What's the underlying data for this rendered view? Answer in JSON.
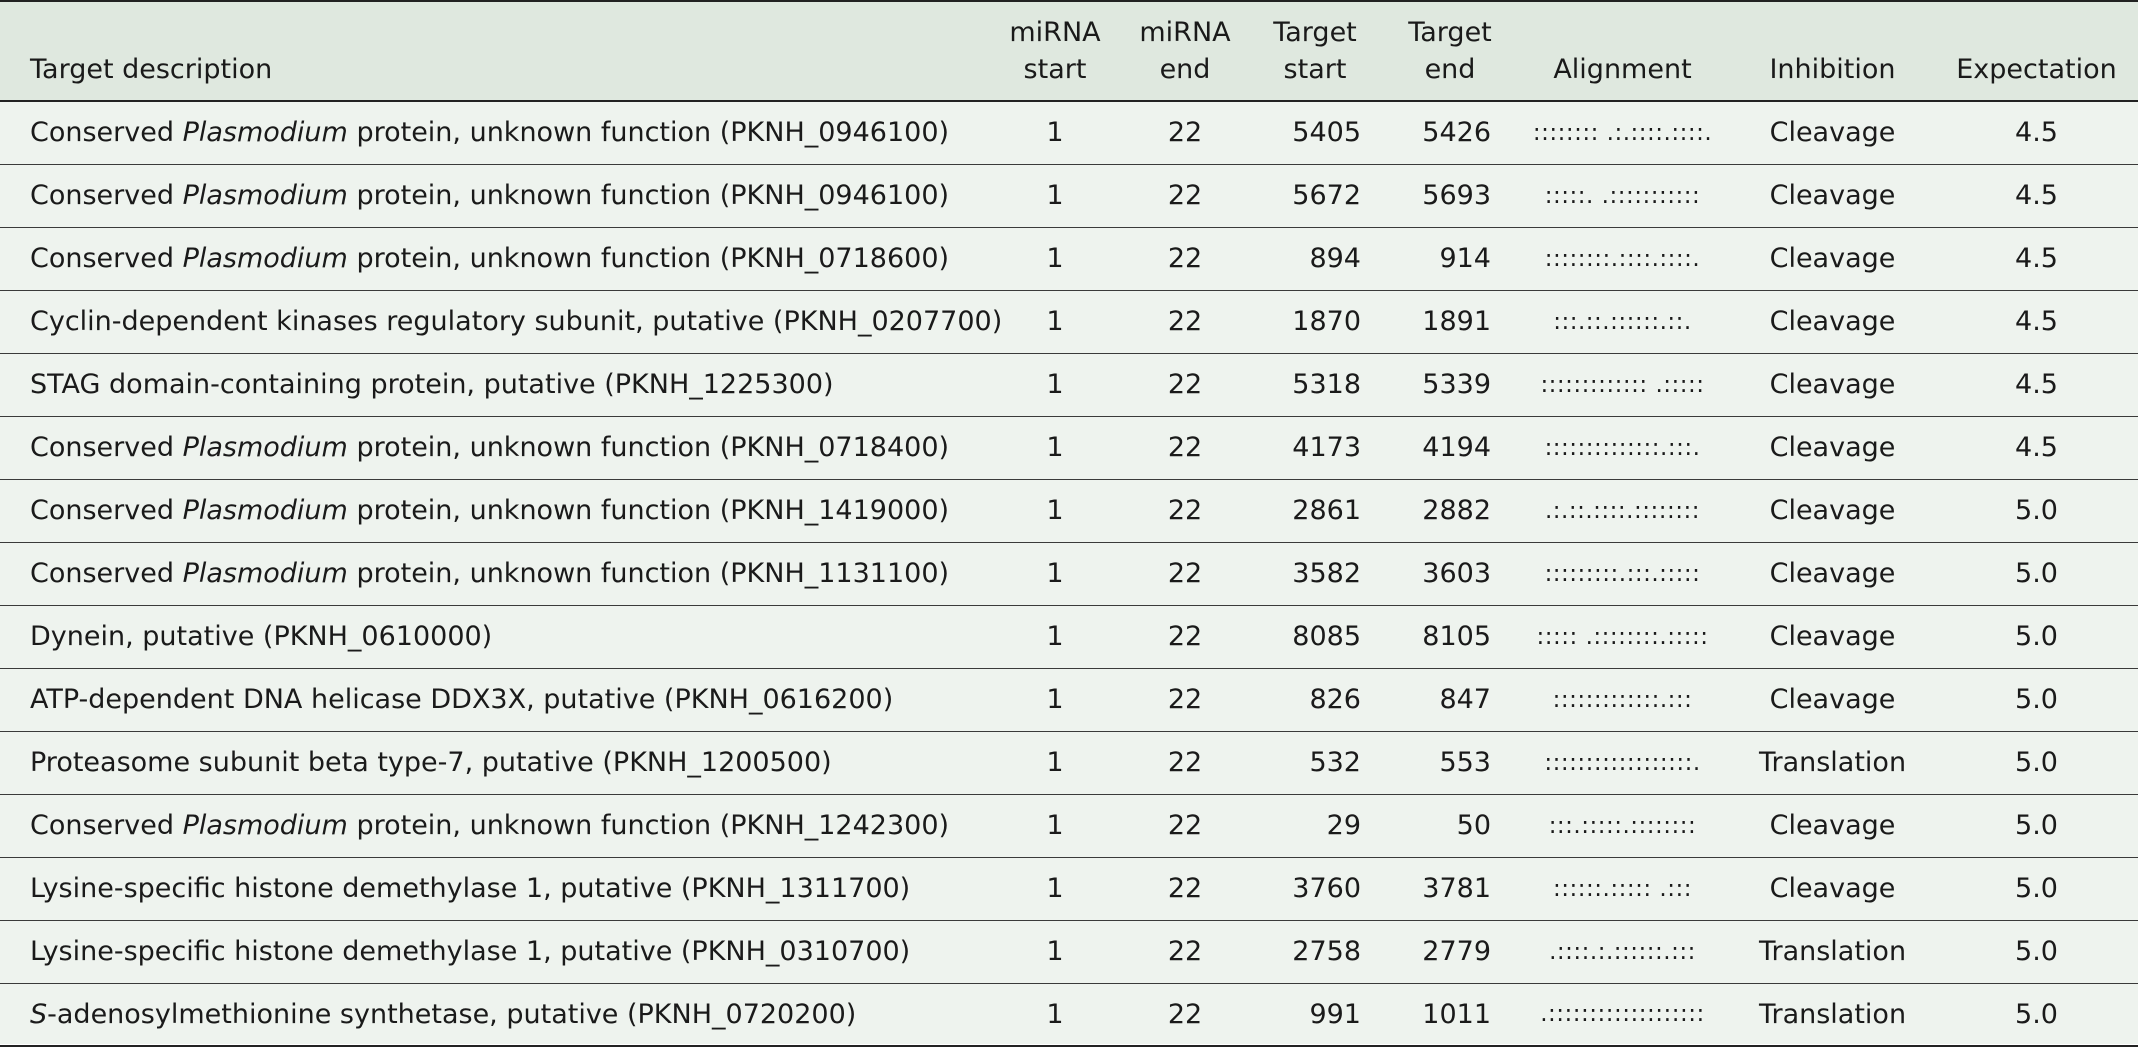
{
  "table": {
    "headers": {
      "desc": "Target description",
      "mirna_start": [
        "miRNA",
        "start"
      ],
      "mirna_end": [
        "miRNA",
        "end"
      ],
      "target_start": [
        "Target",
        "start"
      ],
      "target_end": [
        "Target",
        "end"
      ],
      "alignment": "Alignment",
      "inhibition": "Inhibition",
      "expectation": "Expectation"
    },
    "rows": [
      {
        "desc_pre": "Conserved ",
        "desc_ital": "Plasmodium",
        "desc_post": " protein, unknown function (PKNH_0946100)",
        "mirna_start": "1",
        "mirna_end": "22",
        "target_start": "5405",
        "target_end": "5426",
        "alignment": ":::::::: .:.::::.::::.",
        "inhibition": "Cleavage",
        "expectation": "4.5"
      },
      {
        "desc_pre": "Conserved ",
        "desc_ital": "Plasmodium",
        "desc_post": " protein, unknown function (PKNH_0946100)",
        "mirna_start": "1",
        "mirna_end": "22",
        "target_start": "5672",
        "target_end": "5693",
        "alignment": ":::::. .:::::::::::",
        "inhibition": "Cleavage",
        "expectation": "4.5"
      },
      {
        "desc_pre": "Conserved ",
        "desc_ital": "Plasmodium",
        "desc_post": " protein, unknown function (PKNH_0718600)",
        "mirna_start": "1",
        "mirna_end": "22",
        "target_start": "894",
        "target_end": "914",
        "alignment": "::::::::.::::.::::.",
        "inhibition": "Cleavage",
        "expectation": "4.5"
      },
      {
        "desc_pre": "Cyclin-dependent kinases regulatory subunit, putative (PKNH_0207700)",
        "desc_ital": "",
        "desc_post": "",
        "mirna_start": "1",
        "mirna_end": "22",
        "target_start": "1870",
        "target_end": "1891",
        "alignment": ":::.::.::::::.::.",
        "inhibition": "Cleavage",
        "expectation": "4.5"
      },
      {
        "desc_pre": "STAG domain-containing protein, putative (PKNH_1225300)",
        "desc_ital": "",
        "desc_post": "",
        "mirna_start": "1",
        "mirna_end": "22",
        "target_start": "5318",
        "target_end": "5339",
        "alignment": "::::::::::::: .:::::",
        "inhibition": "Cleavage",
        "expectation": "4.5"
      },
      {
        "desc_pre": "Conserved ",
        "desc_ital": "Plasmodium",
        "desc_post": " protein, unknown function (PKNH_0718400)",
        "mirna_start": "1",
        "mirna_end": "22",
        "target_start": "4173",
        "target_end": "4194",
        "alignment": "::::::::::::::.:::.",
        "inhibition": "Cleavage",
        "expectation": "4.5"
      },
      {
        "desc_pre": "Conserved ",
        "desc_ital": "Plasmodium",
        "desc_post": " protein, unknown function (PKNH_1419000)",
        "mirna_start": "1",
        "mirna_end": "22",
        "target_start": "2861",
        "target_end": "2882",
        "alignment": ".:.::.::::.::::::::",
        "inhibition": "Cleavage",
        "expectation": "5.0"
      },
      {
        "desc_pre": "Conserved ",
        "desc_ital": "Plasmodium",
        "desc_post": " protein, unknown function (PKNH_1131100)",
        "mirna_start": "1",
        "mirna_end": "22",
        "target_start": "3582",
        "target_end": "3603",
        "alignment": ":::::::::.:::.:::::",
        "inhibition": "Cleavage",
        "expectation": "5.0"
      },
      {
        "desc_pre": "Dynein, putative (PKNH_0610000)",
        "desc_ital": "",
        "desc_post": "",
        "mirna_start": "1",
        "mirna_end": "22",
        "target_start": "8085",
        "target_end": "8105",
        "alignment": "::::: .::::::::.:::::",
        "inhibition": "Cleavage",
        "expectation": "5.0"
      },
      {
        "desc_pre": "ATP-dependent DNA helicase DDX3X, putative (PKNH_0616200)",
        "desc_ital": "",
        "desc_post": "",
        "mirna_start": "1",
        "mirna_end": "22",
        "target_start": "826",
        "target_end": "847",
        "alignment": ":::::::::::::.:::",
        "inhibition": "Cleavage",
        "expectation": "5.0"
      },
      {
        "desc_pre": "Proteasome subunit beta type-7, putative (PKNH_1200500)",
        "desc_ital": "",
        "desc_post": "",
        "mirna_start": "1",
        "mirna_end": "22",
        "target_start": "532",
        "target_end": "553",
        "alignment": "::::::::::::::::::.",
        "inhibition": "Translation",
        "expectation": "5.0"
      },
      {
        "desc_pre": "Conserved ",
        "desc_ital": "Plasmodium",
        "desc_post": " protein, unknown function (PKNH_1242300)",
        "mirna_start": "1",
        "mirna_end": "22",
        "target_start": "29",
        "target_end": "50",
        "alignment": ":::.:::::.::::::::",
        "inhibition": "Cleavage",
        "expectation": "5.0"
      },
      {
        "desc_pre": "Lysine-specific histone demethylase 1, putative (PKNH_1311700)",
        "desc_ital": "",
        "desc_post": "",
        "mirna_start": "1",
        "mirna_end": "22",
        "target_start": "3760",
        "target_end": "3781",
        "alignment": "::::::.::::: .:::",
        "inhibition": "Cleavage",
        "expectation": "5.0"
      },
      {
        "desc_pre": "Lysine-specific histone demethylase 1, putative (PKNH_0310700)",
        "desc_ital": "",
        "desc_post": "",
        "mirna_start": "1",
        "mirna_end": "22",
        "target_start": "2758",
        "target_end": "2779",
        "alignment": ".::::.:.::::::.:::",
        "inhibition": "Translation",
        "expectation": "5.0"
      },
      {
        "desc_pre": "",
        "desc_ital": "S",
        "desc_post": "-adenosylmethionine synthetase, putative (PKNH_0720200)",
        "mirna_start": "1",
        "mirna_end": "22",
        "target_start": "991",
        "target_end": "1011",
        "alignment": ".:::::::::::::::::::",
        "inhibition": "Translation",
        "expectation": "5.0"
      }
    ]
  }
}
